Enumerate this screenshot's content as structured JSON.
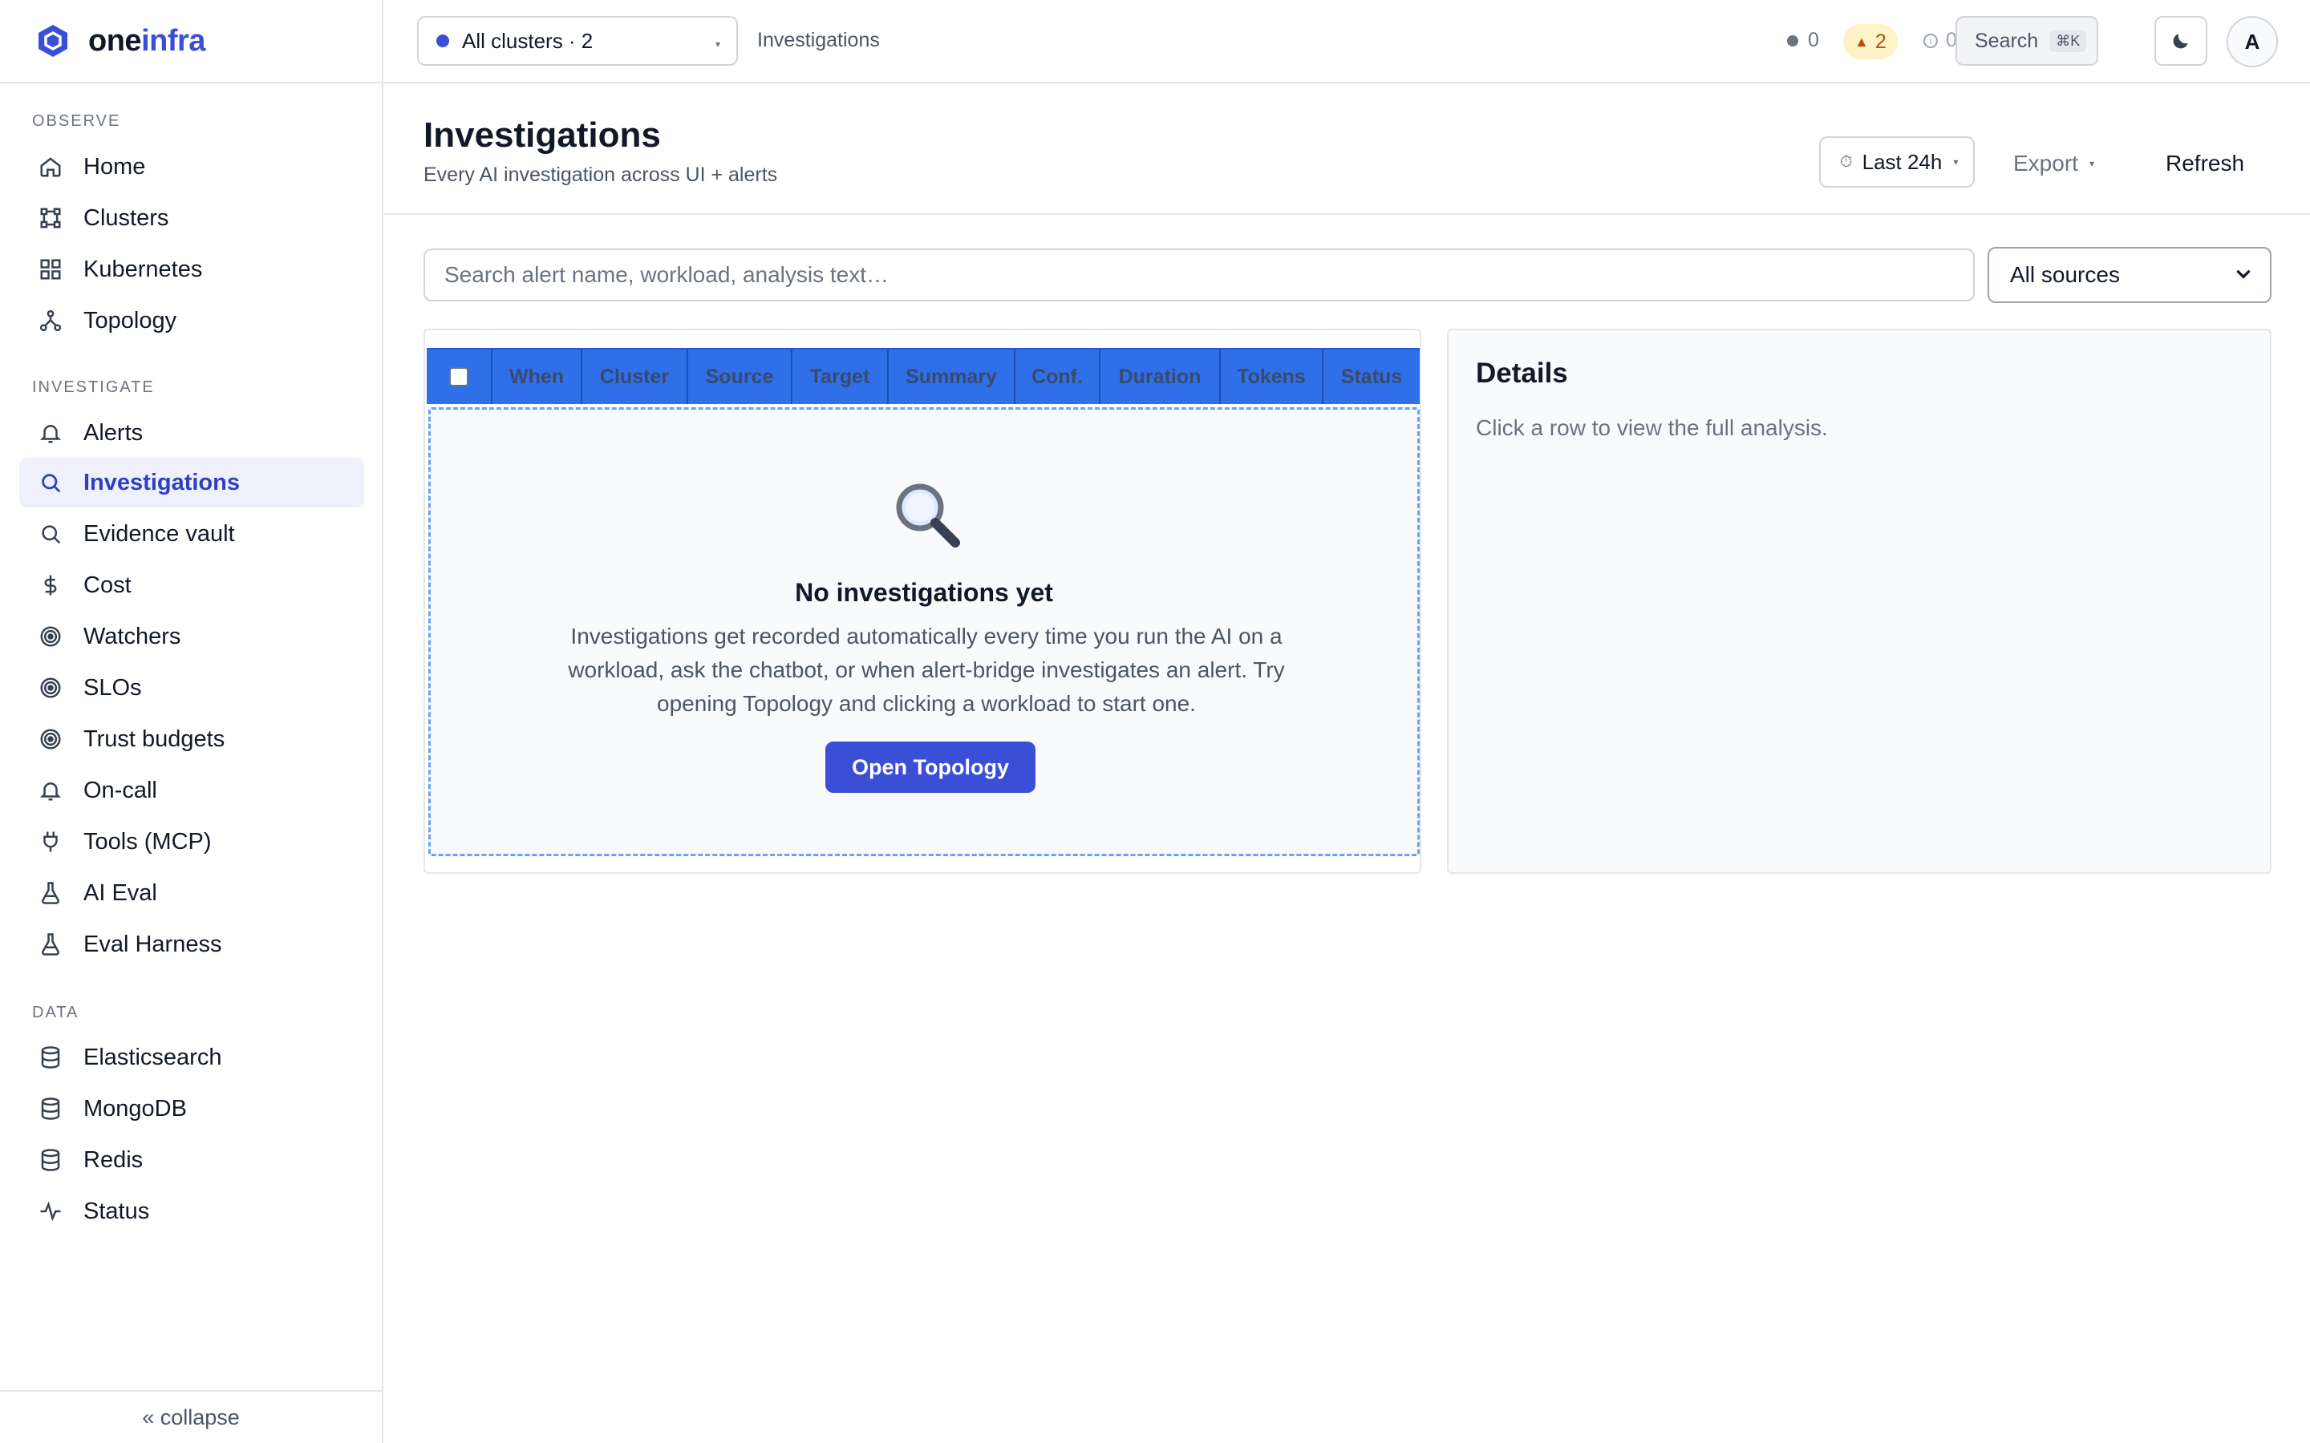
{
  "brand": {
    "name_part1": "one",
    "name_part2": "infra",
    "logo_icon": "hexagon-logo-icon"
  },
  "sidebar": {
    "sections": [
      {
        "label": "OBSERVE",
        "items": [
          {
            "label": "Home",
            "icon": "home-icon"
          },
          {
            "label": "Clusters",
            "icon": "clusters-icon"
          },
          {
            "label": "Kubernetes",
            "icon": "grid-icon"
          },
          {
            "label": "Topology",
            "icon": "topology-icon"
          }
        ]
      },
      {
        "label": "INVESTIGATE",
        "items": [
          {
            "label": "Alerts",
            "icon": "bell-icon"
          },
          {
            "label": "Investigations",
            "icon": "search-icon",
            "active": true
          },
          {
            "label": "Evidence vault",
            "icon": "search-icon"
          },
          {
            "label": "Cost",
            "icon": "dollar-icon"
          },
          {
            "label": "Watchers",
            "icon": "target-icon"
          },
          {
            "label": "SLOs",
            "icon": "target-icon"
          },
          {
            "label": "Trust budgets",
            "icon": "target-icon"
          },
          {
            "label": "On-call",
            "icon": "bell-icon"
          },
          {
            "label": "Tools (MCP)",
            "icon": "plug-icon"
          },
          {
            "label": "AI Eval",
            "icon": "flask-icon"
          },
          {
            "label": "Eval Harness",
            "icon": "flask-icon"
          }
        ]
      },
      {
        "label": "DATA",
        "items": [
          {
            "label": "Elasticsearch",
            "icon": "database-icon"
          },
          {
            "label": "MongoDB",
            "icon": "database-icon"
          },
          {
            "label": "Redis",
            "icon": "database-icon"
          },
          {
            "label": "Status",
            "icon": "pulse-icon"
          }
        ]
      }
    ],
    "collapse_label": "« collapse"
  },
  "topbar": {
    "cluster_select": "All clusters · 2",
    "breadcrumb": "Investigations",
    "status_ok_count": "0",
    "status_warn_count": "2",
    "status_info_count": "0",
    "search_label": "Search",
    "search_shortcut": "⌘K",
    "avatar_initial": "A"
  },
  "page": {
    "title": "Investigations",
    "subtitle": "Every AI investigation across UI + alerts",
    "time_range": "Last 24h",
    "export_label": "Export",
    "refresh_label": "Refresh"
  },
  "filters": {
    "search_placeholder": "Search alert name, workload, analysis text…",
    "source_selected": "All sources"
  },
  "table": {
    "columns": [
      "When",
      "Cluster",
      "Source",
      "Target",
      "Summary",
      "Conf.",
      "Duration",
      "Tokens",
      "Status"
    ],
    "empty": {
      "title": "No investigations yet",
      "body": "Investigations get recorded automatically every time you run the AI on a workload, ask the chatbot, or when alert-bridge investigates an alert. Try opening Topology and clicking a workload to start one.",
      "cta": "Open Topology"
    }
  },
  "details": {
    "title": "Details",
    "hint": "Click a row to view the full analysis."
  },
  "colors": {
    "accent": "#3b4fd6",
    "table_header": "#2f6fe8",
    "warn_bg": "#fef3c7",
    "warn_fg": "#b45309"
  }
}
